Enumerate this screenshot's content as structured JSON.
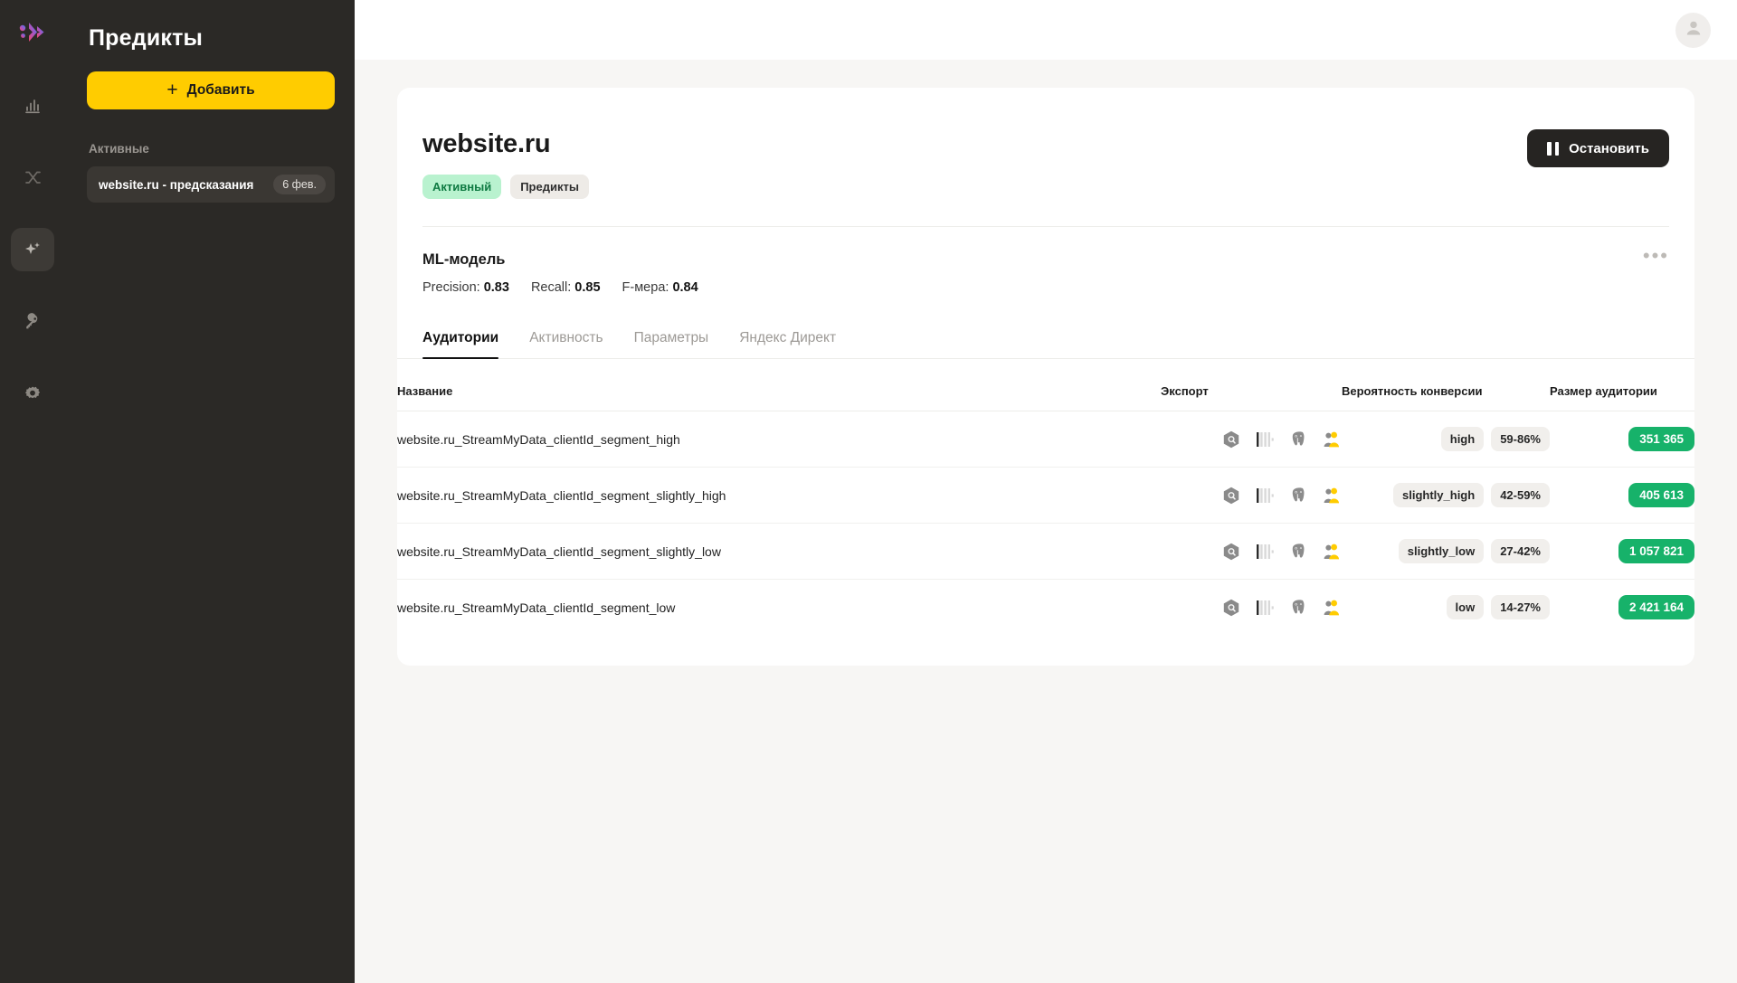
{
  "sidebar": {
    "logo_icon": "predicts-logo-icon",
    "title": "Предикты",
    "add_button": "Добавить",
    "add_icon": "plus-icon",
    "section_label": "Активные",
    "items": [
      {
        "label": "website.ru - предсказания",
        "date": "6 фев."
      }
    ],
    "rail": [
      {
        "icon": "bar-chart-icon",
        "name": "reports",
        "active": false
      },
      {
        "icon": "shuffle-icon",
        "name": "segments",
        "active": false
      },
      {
        "icon": "sparkles-icon",
        "name": "predicts",
        "active": true
      },
      {
        "icon": "key-icon",
        "name": "access",
        "active": false
      },
      {
        "icon": "gear-icon",
        "name": "settings",
        "active": false
      }
    ]
  },
  "topbar": {
    "avatar_icon": "user-avatar-icon"
  },
  "main": {
    "title": "website.ru",
    "chips": [
      {
        "label": "Активный",
        "style": "active"
      },
      {
        "label": "Предикты",
        "style": "plain"
      }
    ],
    "stop_button": "Остановить",
    "stop_icon": "pause-icon",
    "model": {
      "section_title": "ML-модель",
      "more_icon": "ellipsis-icon",
      "metrics": [
        {
          "label": "Precision:",
          "value": "0.83"
        },
        {
          "label": "Recall:",
          "value": "0.85"
        },
        {
          "label": "F-мера:",
          "value": "0.84"
        }
      ]
    },
    "tabs": [
      {
        "label": "Аудитории",
        "active": true
      },
      {
        "label": "Активность",
        "active": false
      },
      {
        "label": "Параметры",
        "active": false
      },
      {
        "label": "Яндекс Директ",
        "active": false
      }
    ],
    "table": {
      "columns": {
        "name": "Название",
        "export": "Экспорт",
        "probability": "Вероятность конверсии",
        "size": "Размер аудитории"
      },
      "export_icons": [
        "hexagon-db-icon",
        "clickhouse-icon",
        "postgresql-icon",
        "yandex-audience-icon"
      ],
      "rows": [
        {
          "name": "website.ru_StreamMyData_clientId_segment_high",
          "segment": "high",
          "probability": "59-86%",
          "size": "351 365"
        },
        {
          "name": "website.ru_StreamMyData_clientId_segment_slightly_high",
          "segment": "slightly_high",
          "probability": "42-59%",
          "size": "405 613"
        },
        {
          "name": "website.ru_StreamMyData_clientId_segment_slightly_low",
          "segment": "slightly_low",
          "probability": "27-42%",
          "size": "1 057 821"
        },
        {
          "name": "website.ru_StreamMyData_clientId_segment_low",
          "segment": "low",
          "probability": "14-27%",
          "size": "2 421 164"
        }
      ]
    }
  },
  "colors": {
    "accent_yellow": "#ffcc00",
    "sidebar_bg": "#2b2926",
    "green_badge": "#17b26a",
    "chip_active_bg": "#b9f2cf",
    "chip_active_text": "#0f7a42"
  }
}
